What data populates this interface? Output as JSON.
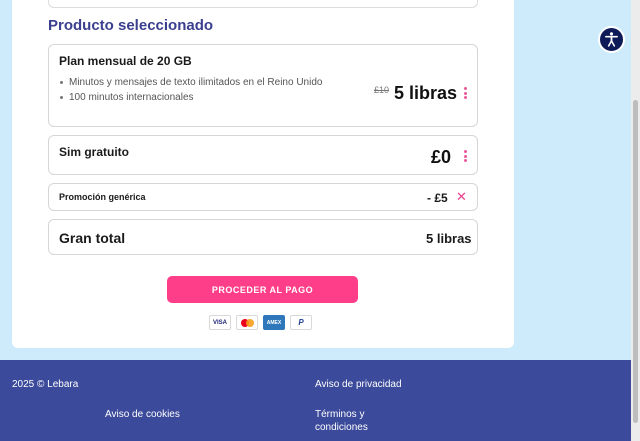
{
  "section_title": "Producto seleccionado",
  "plan": {
    "title": "Plan mensual de 20 GB",
    "features": [
      "Minutos y mensajes de texto ilimitados en el Reino Unido",
      "100 minutos internacionales"
    ],
    "old_price": "£10",
    "price": "5 libras"
  },
  "sim": {
    "title": "Sim gratuito",
    "price": "£0"
  },
  "promo": {
    "title": "Promoción genérica",
    "amount": "- £5",
    "close": "✕"
  },
  "total": {
    "title": "Gran total",
    "value": "5 libras"
  },
  "pay_button": "PROCEDER AL PAGO",
  "payment_methods": {
    "visa": "VISA",
    "amex": "AMEX",
    "paypal": "P"
  },
  "footer": {
    "copyright": "2025 © Lebara",
    "privacy": "Aviso de privacidad",
    "cookies": "Aviso de cookies",
    "terms": "Términos y condiciones"
  },
  "colors": {
    "accent": "#ff3e8a",
    "title": "#3a3f8f",
    "footer_bg": "#3b4a9a",
    "page_bg": "#cdebfa"
  }
}
